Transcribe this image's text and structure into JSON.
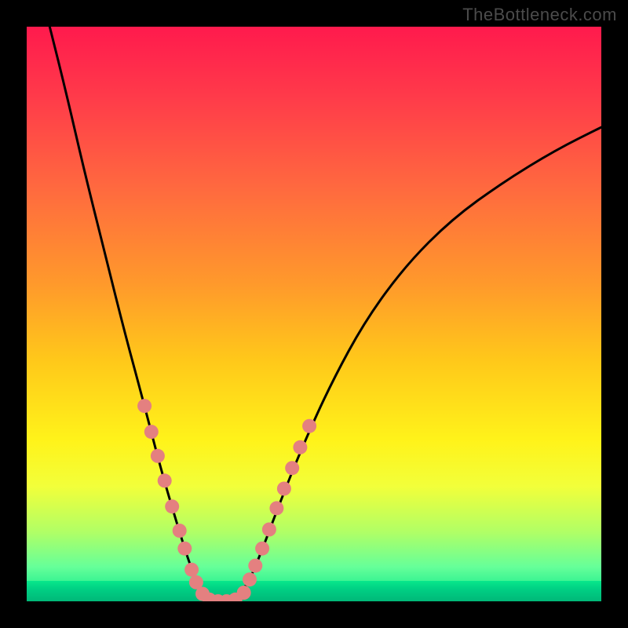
{
  "watermark": {
    "text": "TheBottleneck.com"
  },
  "chart_data": {
    "type": "line",
    "title": "",
    "xlabel": "",
    "ylabel": "",
    "xlim": [
      0,
      100
    ],
    "ylim": [
      0,
      100
    ],
    "grid": false,
    "background_gradient": {
      "top": "#ff1a4d",
      "middle": "#fff31a",
      "bottom": "#00e58a"
    },
    "curve": [
      {
        "x": 4.0,
        "y": 100.0
      },
      {
        "x": 7.0,
        "y": 88.0
      },
      {
        "x": 10.0,
        "y": 75.0
      },
      {
        "x": 13.5,
        "y": 61.0
      },
      {
        "x": 17.0,
        "y": 47.0
      },
      {
        "x": 20.5,
        "y": 34.0
      },
      {
        "x": 23.5,
        "y": 22.5
      },
      {
        "x": 26.0,
        "y": 14.0
      },
      {
        "x": 28.5,
        "y": 6.0
      },
      {
        "x": 30.5,
        "y": 1.5
      },
      {
        "x": 33.0,
        "y": 0.0
      },
      {
        "x": 36.0,
        "y": 0.0
      },
      {
        "x": 38.5,
        "y": 3.0
      },
      {
        "x": 41.0,
        "y": 9.0
      },
      {
        "x": 44.0,
        "y": 17.0
      },
      {
        "x": 48.0,
        "y": 27.0
      },
      {
        "x": 53.0,
        "y": 38.0
      },
      {
        "x": 59.0,
        "y": 49.0
      },
      {
        "x": 66.0,
        "y": 58.5
      },
      {
        "x": 74.0,
        "y": 66.5
      },
      {
        "x": 83.0,
        "y": 73.0
      },
      {
        "x": 92.0,
        "y": 78.5
      },
      {
        "x": 100.0,
        "y": 82.5
      }
    ],
    "markers_left": [
      {
        "x": 20.5,
        "y": 34.0
      },
      {
        "x": 21.7,
        "y": 29.5
      },
      {
        "x": 22.8,
        "y": 25.3
      },
      {
        "x": 24.0,
        "y": 21.0
      },
      {
        "x": 25.3,
        "y": 16.5
      },
      {
        "x": 26.6,
        "y": 12.3
      },
      {
        "x": 27.5,
        "y": 9.2
      },
      {
        "x": 28.7,
        "y": 5.5
      },
      {
        "x": 29.5,
        "y": 3.3
      },
      {
        "x": 30.6,
        "y": 1.3
      }
    ],
    "markers_right": [
      {
        "x": 37.8,
        "y": 1.5
      },
      {
        "x": 38.8,
        "y": 3.8
      },
      {
        "x": 39.8,
        "y": 6.2
      },
      {
        "x": 41.0,
        "y": 9.2
      },
      {
        "x": 42.2,
        "y": 12.5
      },
      {
        "x": 43.5,
        "y": 16.2
      },
      {
        "x": 44.8,
        "y": 19.6
      },
      {
        "x": 46.2,
        "y": 23.2
      },
      {
        "x": 47.6,
        "y": 26.8
      },
      {
        "x": 49.2,
        "y": 30.5
      }
    ],
    "markers_bottom": [
      {
        "x": 31.8,
        "y": 0.3
      },
      {
        "x": 33.3,
        "y": 0.0
      },
      {
        "x": 34.8,
        "y": 0.0
      },
      {
        "x": 36.3,
        "y": 0.3
      }
    ],
    "marker_color": "#e48080",
    "curve_color": "#000000"
  }
}
